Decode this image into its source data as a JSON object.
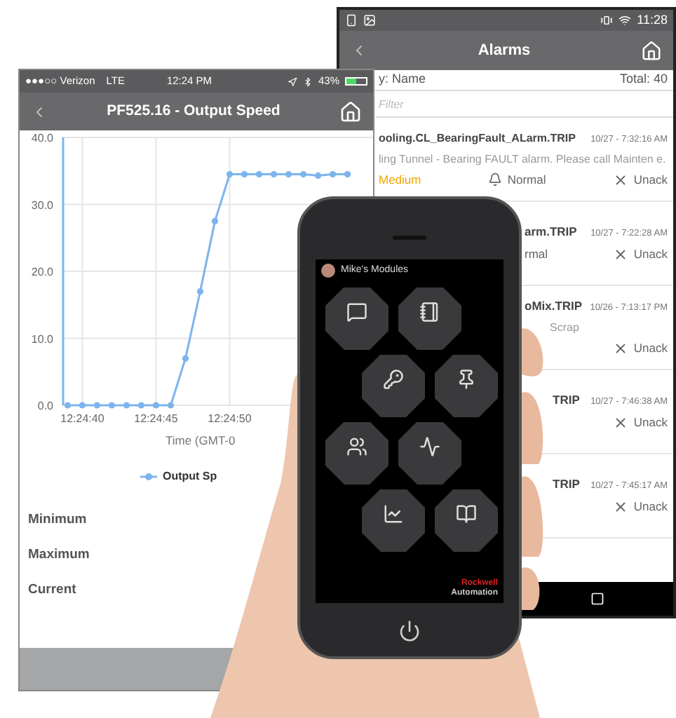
{
  "chart_screen": {
    "status_bar": {
      "carrier": "●●●○○ Verizon",
      "network": "LTE",
      "time": "12:24 PM",
      "battery": "43%"
    },
    "title": "PF525.16 - Output Speed",
    "chart_data": {
      "type": "line",
      "xlabel": "Time (GMT-0",
      "categories": [
        null,
        "12:24:40",
        null,
        null,
        null,
        null,
        "12:24:45",
        null,
        null,
        null,
        null,
        "12:24:50",
        null,
        null,
        null,
        null,
        null,
        null,
        null,
        null
      ],
      "series": [
        {
          "name": "Output Sp",
          "color": "#7cb5ec",
          "marker": true,
          "values": [
            0,
            0,
            0,
            0,
            0,
            0,
            0,
            0,
            7,
            17,
            27.5,
            34.5,
            34.5,
            34.5,
            34.5,
            34.5,
            34.5,
            34.3,
            34.5,
            34.5
          ]
        }
      ],
      "ylim": [
        0,
        40
      ],
      "grid": true,
      "yticks": [
        {
          "value": 0,
          "label": "0.0"
        },
        {
          "value": 10,
          "label": "10.0"
        },
        {
          "value": 20,
          "label": "20.0"
        },
        {
          "value": 30,
          "label": "30.0"
        },
        {
          "value": 40,
          "label": "40.0"
        }
      ]
    },
    "stats": [
      {
        "label": "Minimum"
      },
      {
        "label": "Maximum"
      },
      {
        "label": "Current"
      }
    ]
  },
  "alarms_screen": {
    "status_bar": {
      "time": "11:28"
    },
    "title": "Alarms",
    "sort": "y: Name",
    "total": "Total: 40",
    "filter": {
      "placeholder": "Filter"
    },
    "rows": [
      {
        "name": "ooling.CL_BearingFault_ALarm.TRIP",
        "time": "10/27 - 7:32:16 AM",
        "description": "ling Tunnel - Bearing FAULT alarm. Please call Mainten e.",
        "priority": "Medium",
        "state": "Normal",
        "ack": "Unack"
      },
      {
        "name": "arm.TRIP",
        "time": "10/27 - 7:22:28 AM",
        "state": "rmal",
        "ack": "Unack"
      },
      {
        "name": "oMix.TRIP",
        "time": "10/26 - 7:13:17 PM",
        "description": "Scrap",
        "ack": "Unack"
      },
      {
        "name": "TRIP",
        "time": "10/27 - 7:46:38 AM",
        "ack": "Unack"
      },
      {
        "name": "TRIP",
        "time": "10/27 - 7:45:17 AM",
        "ack": "Unack"
      }
    ]
  },
  "phone": {
    "app_title": "Mike's Modules",
    "logo": [
      "Rockwell",
      "Automation"
    ]
  }
}
